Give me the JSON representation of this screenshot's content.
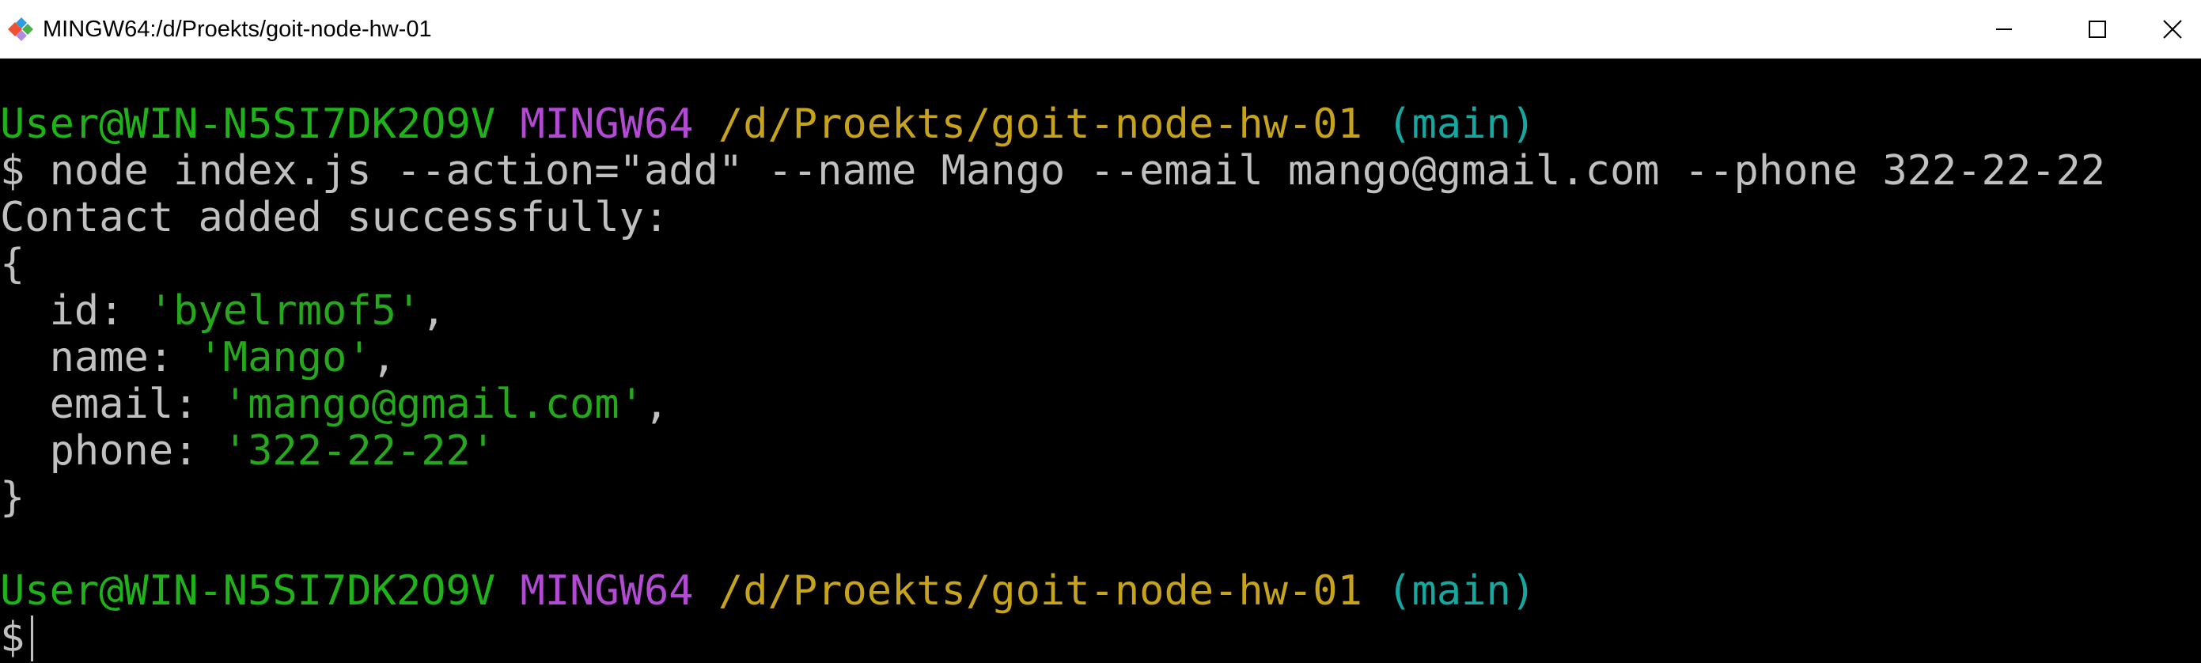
{
  "window": {
    "title": "MINGW64:/d/Proekts/goit-node-hw-01",
    "icon": "git-bash-icon",
    "controls": {
      "minimize_icon": "minimize-icon",
      "maximize_icon": "maximize-icon",
      "close_icon": "close-icon"
    }
  },
  "colors": {
    "prompt_user": "#1fb319",
    "prompt_system": "#b24ad3",
    "prompt_path": "#c6a31a",
    "prompt_branch": "#16a7a0",
    "text": "#c0c0c0",
    "string": "#25a81b",
    "background": "#000000"
  },
  "terminal": {
    "prompt1": {
      "user": "User@WIN-N5SI7DK2O9V",
      "system": "MINGW64",
      "path": "/d/Proekts/goit-node-hw-01",
      "branch": "(main)"
    },
    "command": {
      "symbol": "$",
      "text": "node index.js --action=\"add\" --name Mango --email mango@gmail.com --phone 322-22-22"
    },
    "output": {
      "message": "Contact added successfully:",
      "open_brace": "{",
      "close_brace": "}",
      "fields": [
        {
          "key": "id",
          "value": "'byelrmof5'",
          "suffix": ","
        },
        {
          "key": "name",
          "value": "'Mango'",
          "suffix": ","
        },
        {
          "key": "email",
          "value": "'mango@gmail.com'",
          "suffix": ","
        },
        {
          "key": "phone",
          "value": "'322-22-22'",
          "suffix": ""
        }
      ]
    },
    "prompt2": {
      "user": "User@WIN-N5SI7DK2O9V",
      "system": "MINGW64",
      "path": "/d/Proekts/goit-node-hw-01",
      "branch": "(main)"
    },
    "input_symbol": "$"
  }
}
